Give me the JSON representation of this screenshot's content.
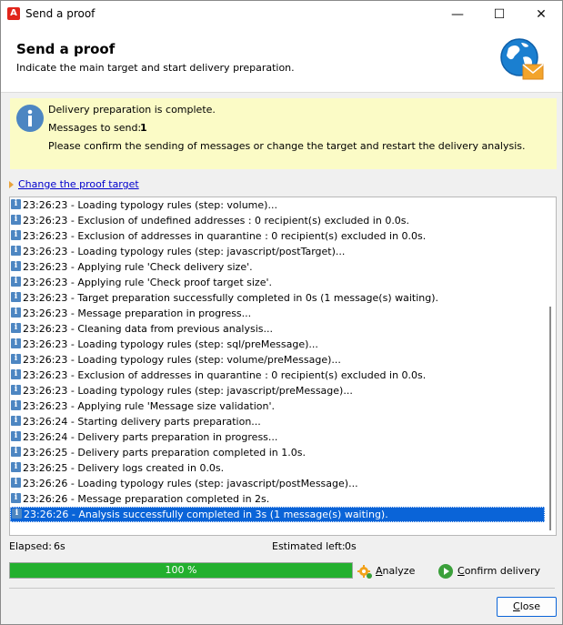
{
  "window": {
    "title": "Send a proof",
    "minimize_glyph": "—",
    "maximize_glyph": "☐",
    "close_glyph": "✕"
  },
  "header": {
    "title": "Send a proof",
    "subtitle": "Indicate the main target and start delivery preparation.",
    "icon": "globe-mail-icon"
  },
  "info": {
    "icon": "info-icon",
    "line1": "Delivery preparation is complete.",
    "messages_label": "Messages to send:",
    "messages_value": "1",
    "line3": "Please confirm the sending of messages or change the target and restart the delivery analysis."
  },
  "proof_link": "Change the proof target",
  "log": [
    "23:26:23 - Loading typology rules (step: volume)...",
    "23:26:23 - Exclusion of undefined addresses : 0 recipient(s) excluded in 0.0s.",
    "23:26:23 - Exclusion of addresses in quarantine : 0 recipient(s) excluded in 0.0s.",
    "23:26:23 - Loading typology rules (step: javascript/postTarget)...",
    "23:26:23 - Applying rule 'Check delivery size'.",
    "23:26:23 - Applying rule 'Check proof target size'.",
    "23:26:23 - Target preparation successfully completed in 0s (1 message(s) waiting).",
    "23:26:23 - Message preparation in progress...",
    "23:26:23 - Cleaning data from previous analysis...",
    "23:26:23 - Loading typology rules (step: sql/preMessage)...",
    "23:26:23 - Loading typology rules (step: volume/preMessage)...",
    "23:26:23 - Exclusion of addresses in quarantine : 0 recipient(s) excluded in 0.0s.",
    "23:26:23 - Loading typology rules (step: javascript/preMessage)...",
    "23:26:23 - Applying rule 'Message size validation'.",
    "23:26:24 - Starting delivery parts preparation...",
    "23:26:24 - Delivery parts preparation in progress...",
    "23:26:25 - Delivery parts preparation completed in 1.0s.",
    "23:26:25 - Delivery logs created in 0.0s.",
    "23:26:26 - Loading typology rules (step: javascript/postMessage)...",
    "23:26:26 - Message preparation completed in 2s.",
    "23:26:26 - Analysis successfully completed in 3s (1 message(s) waiting)."
  ],
  "status": {
    "elapsed_label": "Elapsed:",
    "elapsed_value": "6s",
    "estimated_label": "Estimated left:",
    "estimated_value": "0s"
  },
  "progress": {
    "value": 1.0,
    "label": "100 %",
    "color": "#23b02e"
  },
  "buttons": {
    "analyze_key": "A",
    "analyze_rest": "nalyze",
    "confirm_key": "C",
    "confirm_rest": "onfirm delivery",
    "close_key": "C",
    "close_rest": "lose"
  },
  "colors": {
    "accent": "#0a64d8",
    "banner": "#fbfbc6",
    "brand": "#e1251b"
  }
}
